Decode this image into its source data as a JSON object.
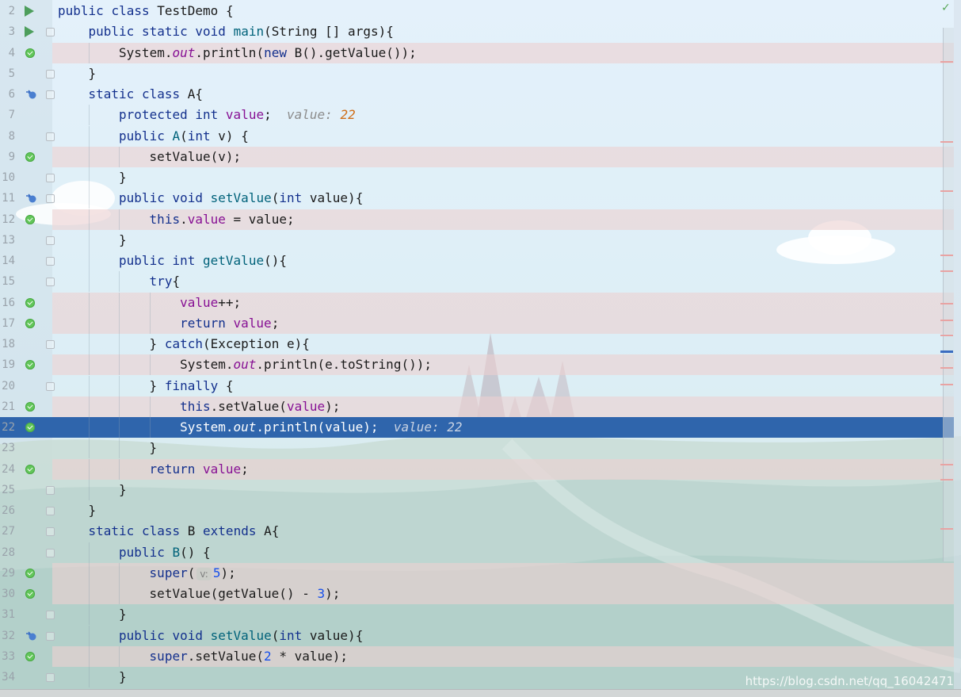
{
  "editor": {
    "lines": [
      {
        "num": "2",
        "icon": "run",
        "fold": "none",
        "bp": false,
        "cur": false,
        "indent": 0,
        "tokens": [
          [
            "kw",
            "public"
          ],
          [
            "t",
            " "
          ],
          [
            "kw",
            "class"
          ],
          [
            "t",
            " TestDemo "
          ],
          [
            "brc",
            "{"
          ]
        ]
      },
      {
        "num": "3",
        "icon": "run",
        "fold": "open",
        "bp": false,
        "cur": false,
        "indent": 1,
        "tokens": [
          [
            "kw",
            "public"
          ],
          [
            "t",
            " "
          ],
          [
            "kw",
            "static"
          ],
          [
            "t",
            " "
          ],
          [
            "kw",
            "void"
          ],
          [
            "t",
            " "
          ],
          [
            "fn",
            "main"
          ],
          [
            "t",
            "(String [] args)"
          ],
          [
            "brc",
            "{"
          ]
        ]
      },
      {
        "num": "4",
        "icon": "bp",
        "fold": "none",
        "bp": true,
        "cur": false,
        "indent": 2,
        "tokens": [
          [
            "t",
            "System."
          ],
          [
            "sfld",
            "out"
          ],
          [
            "t",
            ".println("
          ],
          [
            "kw",
            "new"
          ],
          [
            "t",
            " B().getValue());"
          ]
        ]
      },
      {
        "num": "5",
        "icon": "none",
        "fold": "close",
        "bp": false,
        "cur": false,
        "indent": 1,
        "tokens": [
          [
            "brc",
            "}"
          ]
        ]
      },
      {
        "num": "6",
        "icon": "override",
        "fold": "open",
        "bp": false,
        "cur": false,
        "indent": 1,
        "tokens": [
          [
            "kw",
            "static"
          ],
          [
            "t",
            " "
          ],
          [
            "kw",
            "class"
          ],
          [
            "t",
            " A"
          ],
          [
            "brc",
            "{"
          ]
        ]
      },
      {
        "num": "7",
        "icon": "none",
        "fold": "none",
        "bp": false,
        "cur": false,
        "indent": 2,
        "tokens": [
          [
            "kw",
            "protected"
          ],
          [
            "t",
            " "
          ],
          [
            "kw",
            "int"
          ],
          [
            "t",
            " "
          ],
          [
            "fld",
            "value"
          ],
          [
            "t",
            ";  "
          ],
          [
            "inlay",
            "value: "
          ],
          [
            "inlay-val",
            "22"
          ]
        ]
      },
      {
        "num": "8",
        "icon": "none",
        "fold": "open",
        "bp": false,
        "cur": false,
        "indent": 2,
        "tokens": [
          [
            "kw",
            "public"
          ],
          [
            "t",
            " "
          ],
          [
            "fn",
            "A"
          ],
          [
            "t",
            "("
          ],
          [
            "kw",
            "int"
          ],
          [
            "t",
            " v) "
          ],
          [
            "brc",
            "{"
          ]
        ]
      },
      {
        "num": "9",
        "icon": "bp",
        "fold": "none",
        "bp": true,
        "cur": false,
        "indent": 3,
        "tokens": [
          [
            "t",
            "setValue(v);"
          ]
        ]
      },
      {
        "num": "10",
        "icon": "none",
        "fold": "close",
        "bp": false,
        "cur": false,
        "indent": 2,
        "tokens": [
          [
            "brc",
            "}"
          ]
        ]
      },
      {
        "num": "11",
        "icon": "override",
        "fold": "open",
        "bp": false,
        "cur": false,
        "indent": 2,
        "tokens": [
          [
            "kw",
            "public"
          ],
          [
            "t",
            " "
          ],
          [
            "kw",
            "void"
          ],
          [
            "t",
            " "
          ],
          [
            "fn",
            "setValue"
          ],
          [
            "t",
            "("
          ],
          [
            "kw",
            "int"
          ],
          [
            "t",
            " value)"
          ],
          [
            "brc",
            "{"
          ]
        ]
      },
      {
        "num": "12",
        "icon": "bp",
        "fold": "none",
        "bp": true,
        "cur": false,
        "indent": 3,
        "tokens": [
          [
            "kw",
            "this"
          ],
          [
            "t",
            "."
          ],
          [
            "fld",
            "value"
          ],
          [
            "t",
            " = value;"
          ]
        ]
      },
      {
        "num": "13",
        "icon": "none",
        "fold": "close",
        "bp": false,
        "cur": false,
        "indent": 2,
        "tokens": [
          [
            "brc",
            "}"
          ]
        ]
      },
      {
        "num": "14",
        "icon": "none",
        "fold": "open",
        "bp": false,
        "cur": false,
        "indent": 2,
        "tokens": [
          [
            "kw",
            "public"
          ],
          [
            "t",
            " "
          ],
          [
            "kw",
            "int"
          ],
          [
            "t",
            " "
          ],
          [
            "fn",
            "getValue"
          ],
          [
            "t",
            "()"
          ],
          [
            "brc",
            "{"
          ]
        ]
      },
      {
        "num": "15",
        "icon": "none",
        "fold": "open",
        "bp": false,
        "cur": false,
        "indent": 3,
        "tokens": [
          [
            "kw",
            "try"
          ],
          [
            "brc",
            "{"
          ]
        ]
      },
      {
        "num": "16",
        "icon": "bp",
        "fold": "none",
        "bp": true,
        "cur": false,
        "indent": 4,
        "tokens": [
          [
            "fld",
            "value"
          ],
          [
            "t",
            "++;"
          ]
        ]
      },
      {
        "num": "17",
        "icon": "bp",
        "fold": "none",
        "bp": true,
        "cur": false,
        "indent": 4,
        "tokens": [
          [
            "kw",
            "return"
          ],
          [
            "t",
            " "
          ],
          [
            "fld",
            "value"
          ],
          [
            "t",
            ";"
          ]
        ]
      },
      {
        "num": "18",
        "icon": "none",
        "fold": "open",
        "bp": false,
        "cur": false,
        "indent": 3,
        "tokens": [
          [
            "brc",
            "}"
          ],
          [
            "t",
            " "
          ],
          [
            "kw",
            "catch"
          ],
          [
            "t",
            "(Exception e)"
          ],
          [
            "brc",
            "{"
          ]
        ]
      },
      {
        "num": "19",
        "icon": "bp",
        "fold": "none",
        "bp": true,
        "cur": false,
        "indent": 4,
        "tokens": [
          [
            "t",
            "System."
          ],
          [
            "sfld",
            "out"
          ],
          [
            "t",
            ".println(e.toString());"
          ]
        ]
      },
      {
        "num": "20",
        "icon": "none",
        "fold": "open",
        "bp": false,
        "cur": false,
        "indent": 3,
        "tokens": [
          [
            "brc",
            "}"
          ],
          [
            "t",
            " "
          ],
          [
            "kw",
            "finally"
          ],
          [
            "t",
            " "
          ],
          [
            "brc",
            "{"
          ]
        ]
      },
      {
        "num": "21",
        "icon": "bp",
        "fold": "none",
        "bp": true,
        "cur": false,
        "indent": 4,
        "tokens": [
          [
            "kw",
            "this"
          ],
          [
            "t",
            ".setValue("
          ],
          [
            "fld",
            "value"
          ],
          [
            "t",
            ");"
          ]
        ]
      },
      {
        "num": "22",
        "icon": "bp",
        "fold": "none",
        "bp": false,
        "cur": true,
        "indent": 4,
        "tokens": [
          [
            "t",
            "System."
          ],
          [
            "sfld",
            "out"
          ],
          [
            "t",
            ".println(value);  "
          ],
          [
            "inlay",
            "value: 22"
          ]
        ]
      },
      {
        "num": "23",
        "icon": "none",
        "fold": "none",
        "bp": false,
        "cur": false,
        "indent": 3,
        "tokens": [
          [
            "brc",
            "}"
          ]
        ]
      },
      {
        "num": "24",
        "icon": "bp",
        "fold": "none",
        "bp": true,
        "cur": false,
        "indent": 3,
        "tokens": [
          [
            "kw",
            "return"
          ],
          [
            "t",
            " "
          ],
          [
            "fld",
            "value"
          ],
          [
            "t",
            ";"
          ]
        ]
      },
      {
        "num": "25",
        "icon": "none",
        "fold": "close",
        "bp": false,
        "cur": false,
        "indent": 2,
        "tokens": [
          [
            "brc",
            "}"
          ]
        ]
      },
      {
        "num": "26",
        "icon": "none",
        "fold": "close",
        "bp": false,
        "cur": false,
        "indent": 1,
        "tokens": [
          [
            "brc",
            "}"
          ]
        ]
      },
      {
        "num": "27",
        "icon": "none",
        "fold": "open",
        "bp": false,
        "cur": false,
        "indent": 1,
        "tokens": [
          [
            "kw",
            "static"
          ],
          [
            "t",
            " "
          ],
          [
            "kw",
            "class"
          ],
          [
            "t",
            " B "
          ],
          [
            "kw",
            "extends"
          ],
          [
            "t",
            " A"
          ],
          [
            "brc",
            "{"
          ]
        ]
      },
      {
        "num": "28",
        "icon": "none",
        "fold": "open",
        "bp": false,
        "cur": false,
        "indent": 2,
        "tokens": [
          [
            "kw",
            "public"
          ],
          [
            "t",
            " "
          ],
          [
            "fn",
            "B"
          ],
          [
            "t",
            "() "
          ],
          [
            "brc",
            "{"
          ]
        ]
      },
      {
        "num": "29",
        "icon": "bp",
        "fold": "none",
        "bp": true,
        "cur": false,
        "indent": 3,
        "tokens": [
          [
            "kw",
            "super"
          ],
          [
            "t",
            "("
          ],
          [
            "hint",
            "v:"
          ],
          [
            "num",
            "5"
          ],
          [
            "t",
            ");"
          ]
        ]
      },
      {
        "num": "30",
        "icon": "bp",
        "fold": "none",
        "bp": true,
        "cur": false,
        "indent": 3,
        "tokens": [
          [
            "t",
            "setValue(getValue() - "
          ],
          [
            "num",
            "3"
          ],
          [
            "t",
            ");"
          ]
        ]
      },
      {
        "num": "31",
        "icon": "none",
        "fold": "close",
        "bp": false,
        "cur": false,
        "indent": 2,
        "tokens": [
          [
            "brc",
            "}"
          ]
        ]
      },
      {
        "num": "32",
        "icon": "override",
        "fold": "open",
        "bp": false,
        "cur": false,
        "indent": 2,
        "tokens": [
          [
            "kw",
            "public"
          ],
          [
            "t",
            " "
          ],
          [
            "kw",
            "void"
          ],
          [
            "t",
            " "
          ],
          [
            "fn",
            "setValue"
          ],
          [
            "t",
            "("
          ],
          [
            "kw",
            "int"
          ],
          [
            "t",
            " value)"
          ],
          [
            "brc",
            "{"
          ]
        ]
      },
      {
        "num": "33",
        "icon": "bp",
        "fold": "none",
        "bp": true,
        "cur": false,
        "indent": 3,
        "tokens": [
          [
            "kw",
            "super"
          ],
          [
            "t",
            ".setValue("
          ],
          [
            "num",
            "2"
          ],
          [
            "t",
            " * value);"
          ]
        ]
      },
      {
        "num": "34",
        "icon": "none",
        "fold": "close",
        "bp": false,
        "cur": false,
        "indent": 2,
        "tokens": [
          [
            "brc",
            "}"
          ]
        ]
      }
    ]
  },
  "inspection_icon": "check-icon",
  "icons": {
    "run": "run-triangle-icon",
    "breakpoint": "breakpoint-check-icon",
    "override": "override-method-icon"
  },
  "colors": {
    "keyword": "#13308d",
    "field": "#871094",
    "method": "#00627a",
    "number": "#1750eb",
    "current_line": "#2f65ac",
    "breakpoint_line": "#ecd0d0"
  },
  "watermark": "https://blog.csdn.net/qq_16042471"
}
